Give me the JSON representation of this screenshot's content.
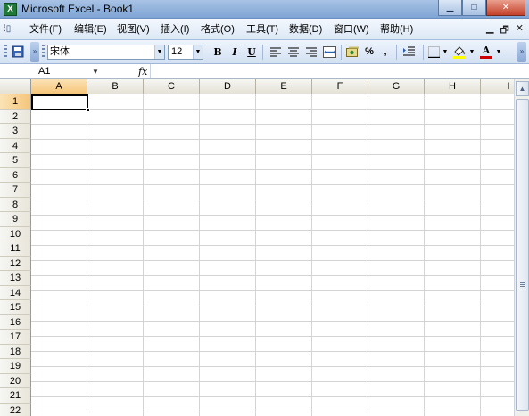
{
  "window": {
    "title": "Microsoft Excel - Book1",
    "app_icon": "X"
  },
  "window_buttons": {
    "minimize": "▁",
    "maximize": "□",
    "close": "✕"
  },
  "menu": {
    "items": [
      "文件(F)",
      "编辑(E)",
      "视图(V)",
      "插入(I)",
      "格式(O)",
      "工具(T)",
      "数据(D)",
      "窗口(W)",
      "帮助(H)"
    ],
    "doc_controls": {
      "minimize": "▁",
      "restore": "🗗",
      "close": "✕"
    }
  },
  "toolbar": {
    "font_name": "宋体",
    "font_size": "12",
    "bold": "B",
    "italic": "I",
    "underline": "U",
    "percent": "%",
    "comma": ",",
    "font_color_label": "A"
  },
  "formula_bar": {
    "name_box": "A1",
    "fx_label": "fx",
    "formula": ""
  },
  "grid": {
    "columns": [
      "A",
      "B",
      "C",
      "D",
      "E",
      "F",
      "G",
      "H",
      "I"
    ],
    "rows": [
      "1",
      "2",
      "3",
      "4",
      "5",
      "6",
      "7",
      "8",
      "9",
      "10",
      "11",
      "12",
      "13",
      "14",
      "15",
      "16",
      "17",
      "18",
      "19",
      "20",
      "21",
      "22"
    ],
    "active_cell": "A1"
  },
  "colors": {
    "title_bar": "#8fb0da",
    "toolbar": "#dde8f6",
    "header_active": "#f6c57a",
    "font_color": "#cc0000",
    "highlight_color": "#ffff00"
  }
}
